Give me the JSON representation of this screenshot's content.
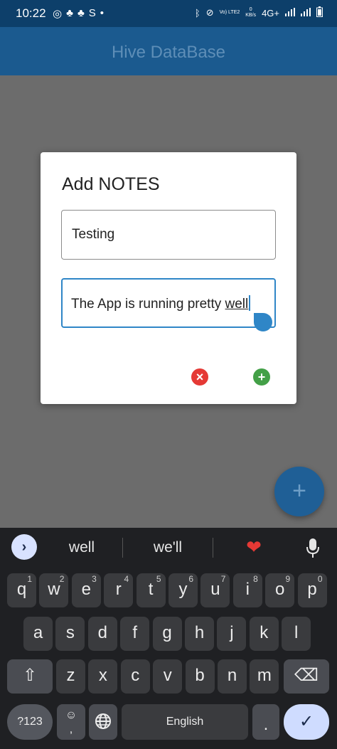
{
  "status_bar": {
    "time": "10:22",
    "left_icons": [
      "whatsapp-icon",
      "snapchat-icon",
      "snapchat-icon",
      "5-icon",
      "dot-icon"
    ],
    "volte_label": "Vo) LTE2",
    "data_rate": "0",
    "data_unit": "KB/s",
    "network": "4G+"
  },
  "app_bar": {
    "title": "Hive DataBase"
  },
  "dialog": {
    "title": "Add NOTES",
    "field1_value": "Testing",
    "field2_value_prefix": "The App is running pretty ",
    "field2_value_word": "well",
    "cancel_icon": "×",
    "add_icon": "+"
  },
  "fab": {
    "icon": "+"
  },
  "keyboard": {
    "suggestions": [
      "well",
      "we'll"
    ],
    "suggestion_emoji": "❤",
    "expand_icon": "›",
    "row1": [
      {
        "k": "q",
        "h": "1"
      },
      {
        "k": "w",
        "h": "2"
      },
      {
        "k": "e",
        "h": "3"
      },
      {
        "k": "r",
        "h": "4"
      },
      {
        "k": "t",
        "h": "5"
      },
      {
        "k": "y",
        "h": "6"
      },
      {
        "k": "u",
        "h": "7"
      },
      {
        "k": "i",
        "h": "8"
      },
      {
        "k": "o",
        "h": "9"
      },
      {
        "k": "p",
        "h": "0"
      }
    ],
    "row2": [
      "a",
      "s",
      "d",
      "f",
      "g",
      "h",
      "j",
      "k",
      "l"
    ],
    "row3": [
      "z",
      "x",
      "c",
      "v",
      "b",
      "n",
      "m"
    ],
    "shift_icon": "⇧",
    "backspace_icon": "⌫",
    "symbols_label": "?123",
    "emoji_icon": "☺",
    "comma_label": ",",
    "globe_icon": "globe",
    "space_label": "English",
    "period_label": ".",
    "enter_icon": "✓",
    "colors": {
      "enter_bg": "#cfdcff",
      "key_bg": "#3a3b3e",
      "keyboard_bg": "#1f2023"
    }
  },
  "colors": {
    "appbar": "#1b5a8f",
    "statusbar": "#0d3f6a",
    "dialog_focus": "#2f86c7",
    "cancel": "#e53935",
    "add": "#43a047"
  }
}
